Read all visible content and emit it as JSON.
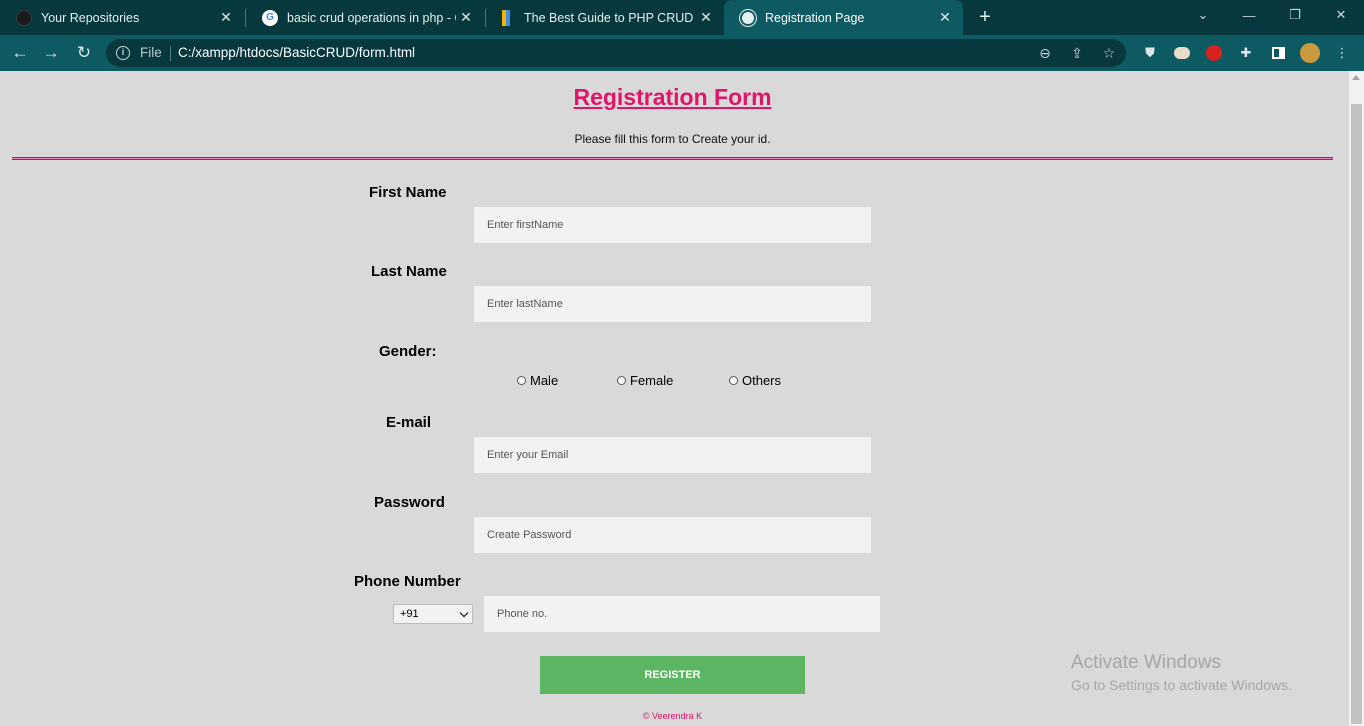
{
  "tabs": [
    {
      "title": "Your Repositories",
      "icon": "github-icon",
      "active": false
    },
    {
      "title": "basic crud operations in php - Go",
      "icon": "google-icon",
      "active": false
    },
    {
      "title": "The Best Guide to PHP CRUD Op",
      "icon": "bookmark-icon",
      "active": false
    },
    {
      "title": "Registration Page",
      "icon": "globe-icon",
      "active": true
    }
  ],
  "address_bar": {
    "scheme_label": "File",
    "url": "C:/xampp/htdocs/BasicCRUD/form.html"
  },
  "form": {
    "title": "Registration Form",
    "subtitle": "Please fill this form to Create your id.",
    "first_name": {
      "label": "First Name",
      "placeholder": "Enter firstName",
      "value": ""
    },
    "last_name": {
      "label": "Last Name",
      "placeholder": "Enter lastName",
      "value": ""
    },
    "gender": {
      "label": "Gender:",
      "options": [
        "Male",
        "Female",
        "Others"
      ],
      "selected": null
    },
    "email": {
      "label": "E-mail",
      "placeholder": "Enter your Email",
      "value": ""
    },
    "password": {
      "label": "Password",
      "placeholder": "Create Password",
      "value": ""
    },
    "phone": {
      "label": "Phone Number",
      "country_code": "+91",
      "placeholder": "Phone no.",
      "value": ""
    },
    "register_label": "REGISTER",
    "footer": "© Veerendra K"
  },
  "watermark": {
    "line1": "Activate Windows",
    "line2": "Go to Settings to activate Windows."
  },
  "colors": {
    "title": "#e0156a",
    "register_button": "#5cb562",
    "browser_frame": "#06383e",
    "browser_toolbar": "#0d5a63",
    "page_background": "#d9d9d9"
  }
}
